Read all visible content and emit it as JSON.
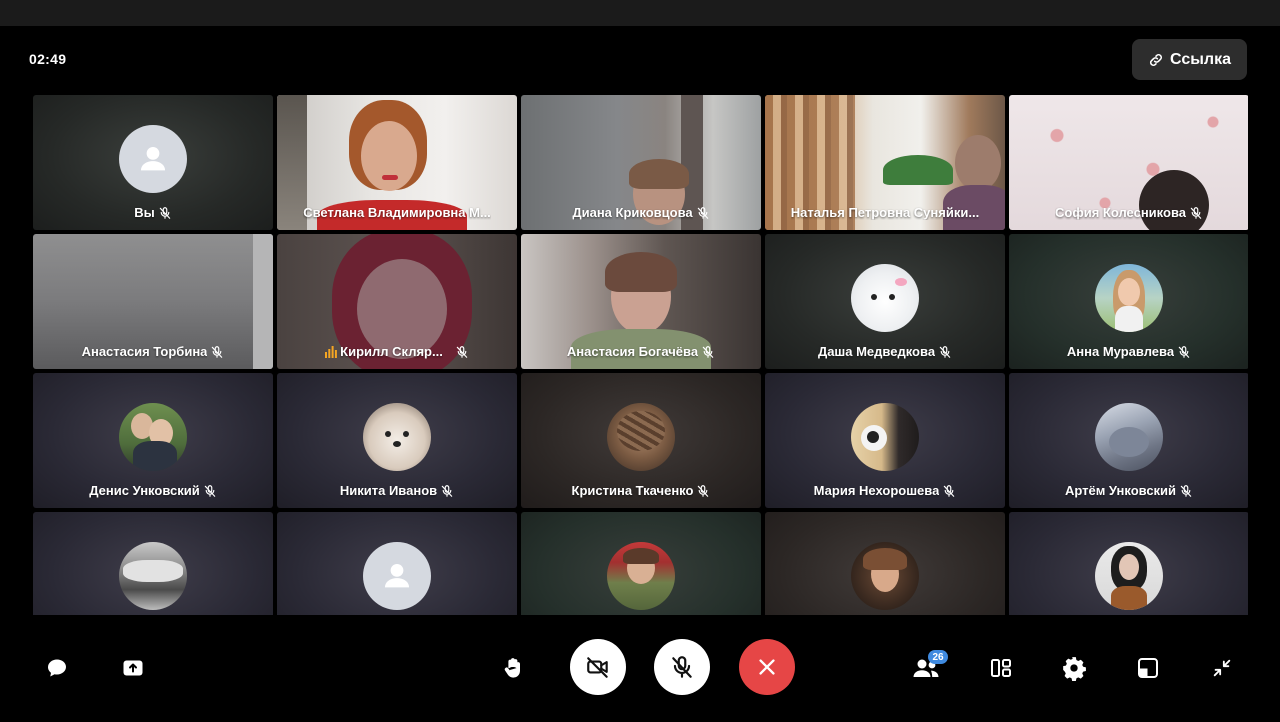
{
  "call": {
    "timer": "02:49",
    "link_label": "Ссылка"
  },
  "participants": [
    {
      "name": "Вы",
      "mic": "off",
      "view": "placeholder"
    },
    {
      "name": "Светлана Владимировна М...",
      "mic": "none",
      "view": "video"
    },
    {
      "name": "Диана Криковцова",
      "mic": "off",
      "view": "video"
    },
    {
      "name": "Наталья Петровна Суняйки...",
      "mic": "none",
      "view": "video"
    },
    {
      "name": "София Колесникова",
      "mic": "off",
      "view": "video"
    },
    {
      "name": "Анастасия Торбина",
      "mic": "off",
      "view": "video"
    },
    {
      "name": "Кирилл Скляр...",
      "mic": "off",
      "view": "video",
      "speaking": true
    },
    {
      "name": "Анастасия Богачёва",
      "mic": "off",
      "view": "video"
    },
    {
      "name": "Даша Медведкова",
      "mic": "off",
      "view": "avatar"
    },
    {
      "name": "Анна Муравлева",
      "mic": "off",
      "view": "avatar"
    },
    {
      "name": "Денис Унковский",
      "mic": "off",
      "view": "avatar"
    },
    {
      "name": "Никита Иванов",
      "mic": "off",
      "view": "avatar"
    },
    {
      "name": "Кристина Ткаченко",
      "mic": "off",
      "view": "avatar"
    },
    {
      "name": "Мария Нехорошева",
      "mic": "off",
      "view": "avatar"
    },
    {
      "name": "Артём Унковский",
      "mic": "off",
      "view": "avatar"
    },
    {
      "name": "",
      "mic": "none",
      "view": "avatar"
    },
    {
      "name": "",
      "mic": "none",
      "view": "placeholder"
    },
    {
      "name": "",
      "mic": "none",
      "view": "avatar"
    },
    {
      "name": "",
      "mic": "none",
      "view": "avatar"
    },
    {
      "name": "",
      "mic": "none",
      "view": "avatar"
    }
  ],
  "toolbar": {
    "participants_count": "26"
  },
  "icons": {
    "chat": "chat-icon",
    "share_screen": "share-screen-icon",
    "raise_hand": "hand-icon",
    "camera": "camera-off-icon",
    "microphone": "microphone-off-icon",
    "end_call": "close-icon",
    "participants": "people-icon",
    "layout": "layout-icon",
    "settings": "gear-icon",
    "window_mode": "window-mode-icon",
    "minimize": "minimize-icon"
  },
  "colors": {
    "background": "#000000",
    "end_call": "#e64646",
    "badge": "#3f8ae0",
    "link_button": "#2d2d2d",
    "speaking": "#f5a623"
  }
}
